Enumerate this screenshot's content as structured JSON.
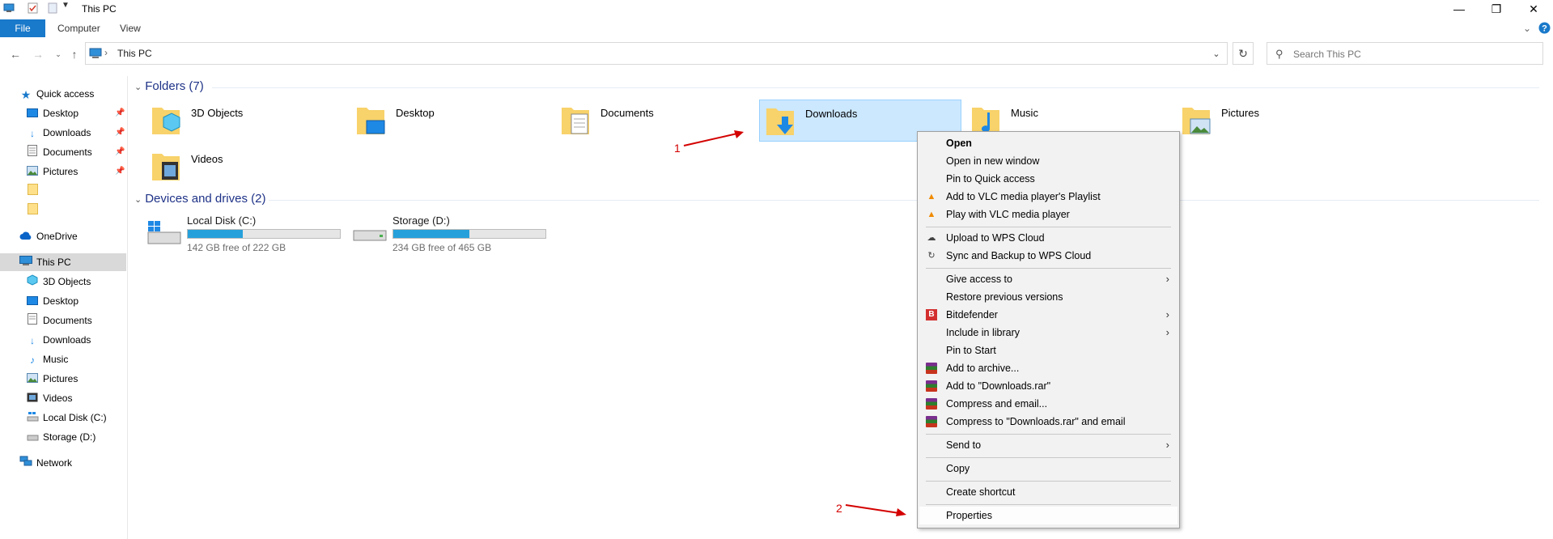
{
  "window": {
    "title": "This PC",
    "controls": [
      "minimize-icon",
      "restore-icon",
      "close-icon"
    ]
  },
  "ribbon": {
    "tabs": [
      "File",
      "Computer",
      "View"
    ]
  },
  "address": {
    "location": "This PC"
  },
  "search": {
    "placeholder": "Search This PC"
  },
  "sidebar": {
    "quick_access": "Quick access",
    "quick_items": [
      "Desktop",
      "Downloads",
      "Documents",
      "Pictures"
    ],
    "onedrive": "OneDrive",
    "this_pc": "This PC",
    "pc_items": [
      "3D Objects",
      "Desktop",
      "Documents",
      "Downloads",
      "Music",
      "Pictures",
      "Videos",
      "Local Disk (C:)",
      "Storage (D:)"
    ],
    "network": "Network"
  },
  "main": {
    "folders_header": "Folders (7)",
    "folders": [
      "3D Objects",
      "Desktop",
      "Documents",
      "Downloads",
      "Music",
      "Pictures",
      "Videos"
    ],
    "drives_header": "Devices and drives (2)",
    "drives": [
      {
        "name": "Local Disk (C:)",
        "free": "142 GB free of 222 GB",
        "used_fraction": 0.36
      },
      {
        "name": "Storage (D:)",
        "free": "234 GB free of 465 GB",
        "used_fraction": 0.5
      }
    ]
  },
  "annotations": {
    "one": "1",
    "two": "2"
  },
  "context_menu": {
    "items": [
      "Open",
      "Open in new window",
      "Pin to Quick access",
      "Add to VLC media player's Playlist",
      "Play with VLC media player",
      "Upload to WPS Cloud",
      "Sync and Backup to WPS Cloud",
      "Give access to",
      "Restore previous versions",
      "Bitdefender",
      "Include in library",
      "Pin to Start",
      "Add to archive...",
      "Add to \"Downloads.rar\"",
      "Compress and email...",
      "Compress to \"Downloads.rar\" and email",
      "Send to",
      "Copy",
      "Create shortcut",
      "Properties"
    ]
  },
  "colors": {
    "accent": "#1979ca",
    "selection": "#cce8ff",
    "header": "#1e3287",
    "drive_bar": "#26a0da",
    "annotation": "#d40000"
  }
}
